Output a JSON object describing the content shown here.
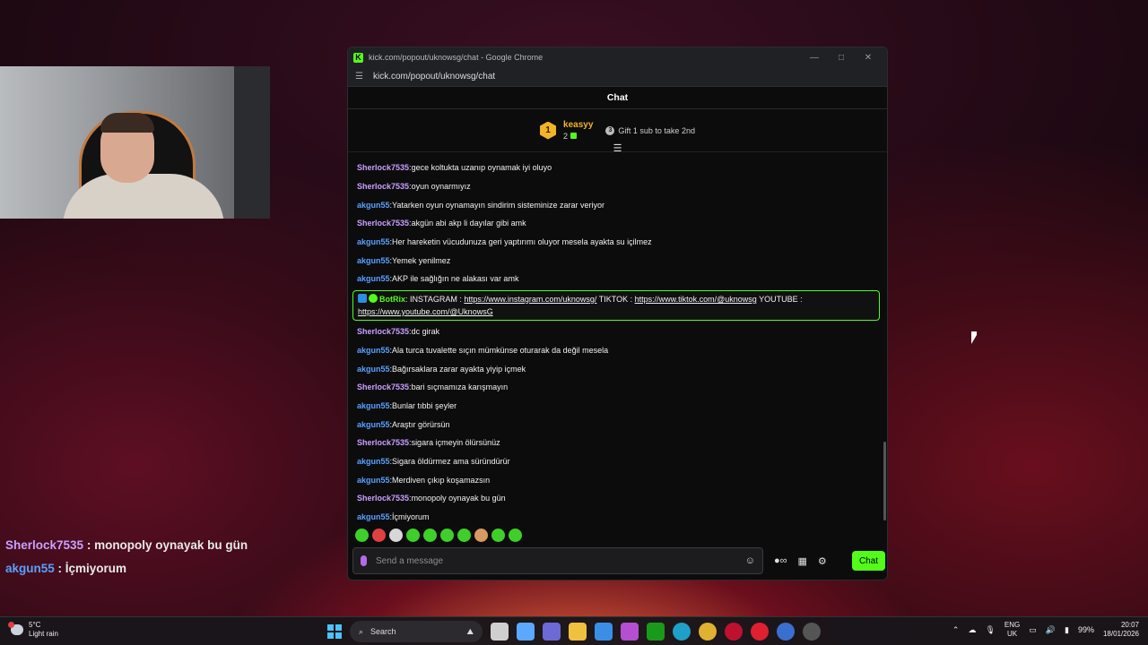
{
  "browser": {
    "window_title": "kick.com/popout/uknowsg/chat - Google Chrome",
    "url": "kick.com/popout/uknowsg/chat",
    "controls": {
      "minimize": "—",
      "maximize": "□",
      "close": "✕"
    }
  },
  "chat": {
    "header": "Chat",
    "pinned_gifter": {
      "rank": "1",
      "name": "keasyy",
      "count": "2",
      "cta": "Gift 1 sub to take 2nd"
    },
    "messages": [
      {
        "user": "Sherlock7535",
        "color": "#c9a0ff",
        "text": "gece koltukta uzanıp oynamak iyi oluyo"
      },
      {
        "user": "Sherlock7535",
        "color": "#c9a0ff",
        "text": "oyun oynarmıyız"
      },
      {
        "user": "akgun55",
        "color": "#5aa0ff",
        "text": "Yatarken oyun oynamayın sindirim sisteminize zarar veriyor"
      },
      {
        "user": "Sherlock7535",
        "color": "#c9a0ff",
        "text": "akgün abi akp li dayılar gibi amk"
      },
      {
        "user": "akgun55",
        "color": "#5aa0ff",
        "text": "Her hareketin vücudunuza geri yaptırımı oluyor mesela ayakta su içilmez"
      },
      {
        "user": "akgun55",
        "color": "#5aa0ff",
        "text": "Yemek yenilmez"
      },
      {
        "user": "akgun55",
        "color": "#5aa0ff",
        "text": "AKP ile sağlığın ne alakası var amk"
      }
    ],
    "botrix": {
      "name": "BotRix",
      "label_instagram": "INSTAGRAM : ",
      "instagram": "https://www.instagram.com/uknowsg/",
      "label_tiktok": " TIKTOK : ",
      "tiktok": "https://www.tiktok.com/@uknowsg",
      "label_youtube": " YOUTUBE : ",
      "youtube": "https://www.youtube.com/@UknowsG"
    },
    "messages_after": [
      {
        "user": "Sherlock7535",
        "color": "#c9a0ff",
        "text": "dc girak"
      },
      {
        "user": "akgun55",
        "color": "#5aa0ff",
        "text": "Ala turca tuvalette sıçın mümkünse oturarak da değil mesela"
      },
      {
        "user": "akgun55",
        "color": "#5aa0ff",
        "text": "Bağırsaklara zarar ayakta yiyip içmek"
      },
      {
        "user": "Sherlock7535",
        "color": "#c9a0ff",
        "text": "bari sıçmamıza karışmayın"
      },
      {
        "user": "akgun55",
        "color": "#5aa0ff",
        "text": "Bunlar tıbbi şeyler"
      },
      {
        "user": "akgun55",
        "color": "#5aa0ff",
        "text": "Araştır görürsün"
      },
      {
        "user": "Sherlock7535",
        "color": "#c9a0ff",
        "text": "sigara içmeyin ölürsünüz"
      },
      {
        "user": "akgun55",
        "color": "#5aa0ff",
        "text": "Sigara öldürmez ama süründürür"
      },
      {
        "user": "akgun55",
        "color": "#5aa0ff",
        "text": "Merdiven çıkıp koşamazsın"
      },
      {
        "user": "Sherlock7535",
        "color": "#c9a0ff",
        "text": "monopoly oynayak bu gün"
      },
      {
        "user": "akgun55",
        "color": "#5aa0ff",
        "text": "İçmiyorum"
      }
    ],
    "input_placeholder": "Send a message",
    "send_label": "Chat"
  },
  "overlay": [
    {
      "user": "Sherlock7535",
      "color": "#c9a0ff",
      "text": "monopoly oynayak bu gün"
    },
    {
      "user": "akgun55",
      "color": "#5aa0ff",
      "text": "İçmiyorum"
    }
  ],
  "taskbar": {
    "weather_temp": "5°C",
    "weather_desc": "Light rain",
    "search_label": "Search",
    "lang_top": "ENG",
    "lang_bottom": "UK",
    "battery": "99%",
    "time": "20:07",
    "date": "18/01/2026"
  },
  "colors": {
    "accent": "#53fc18"
  }
}
